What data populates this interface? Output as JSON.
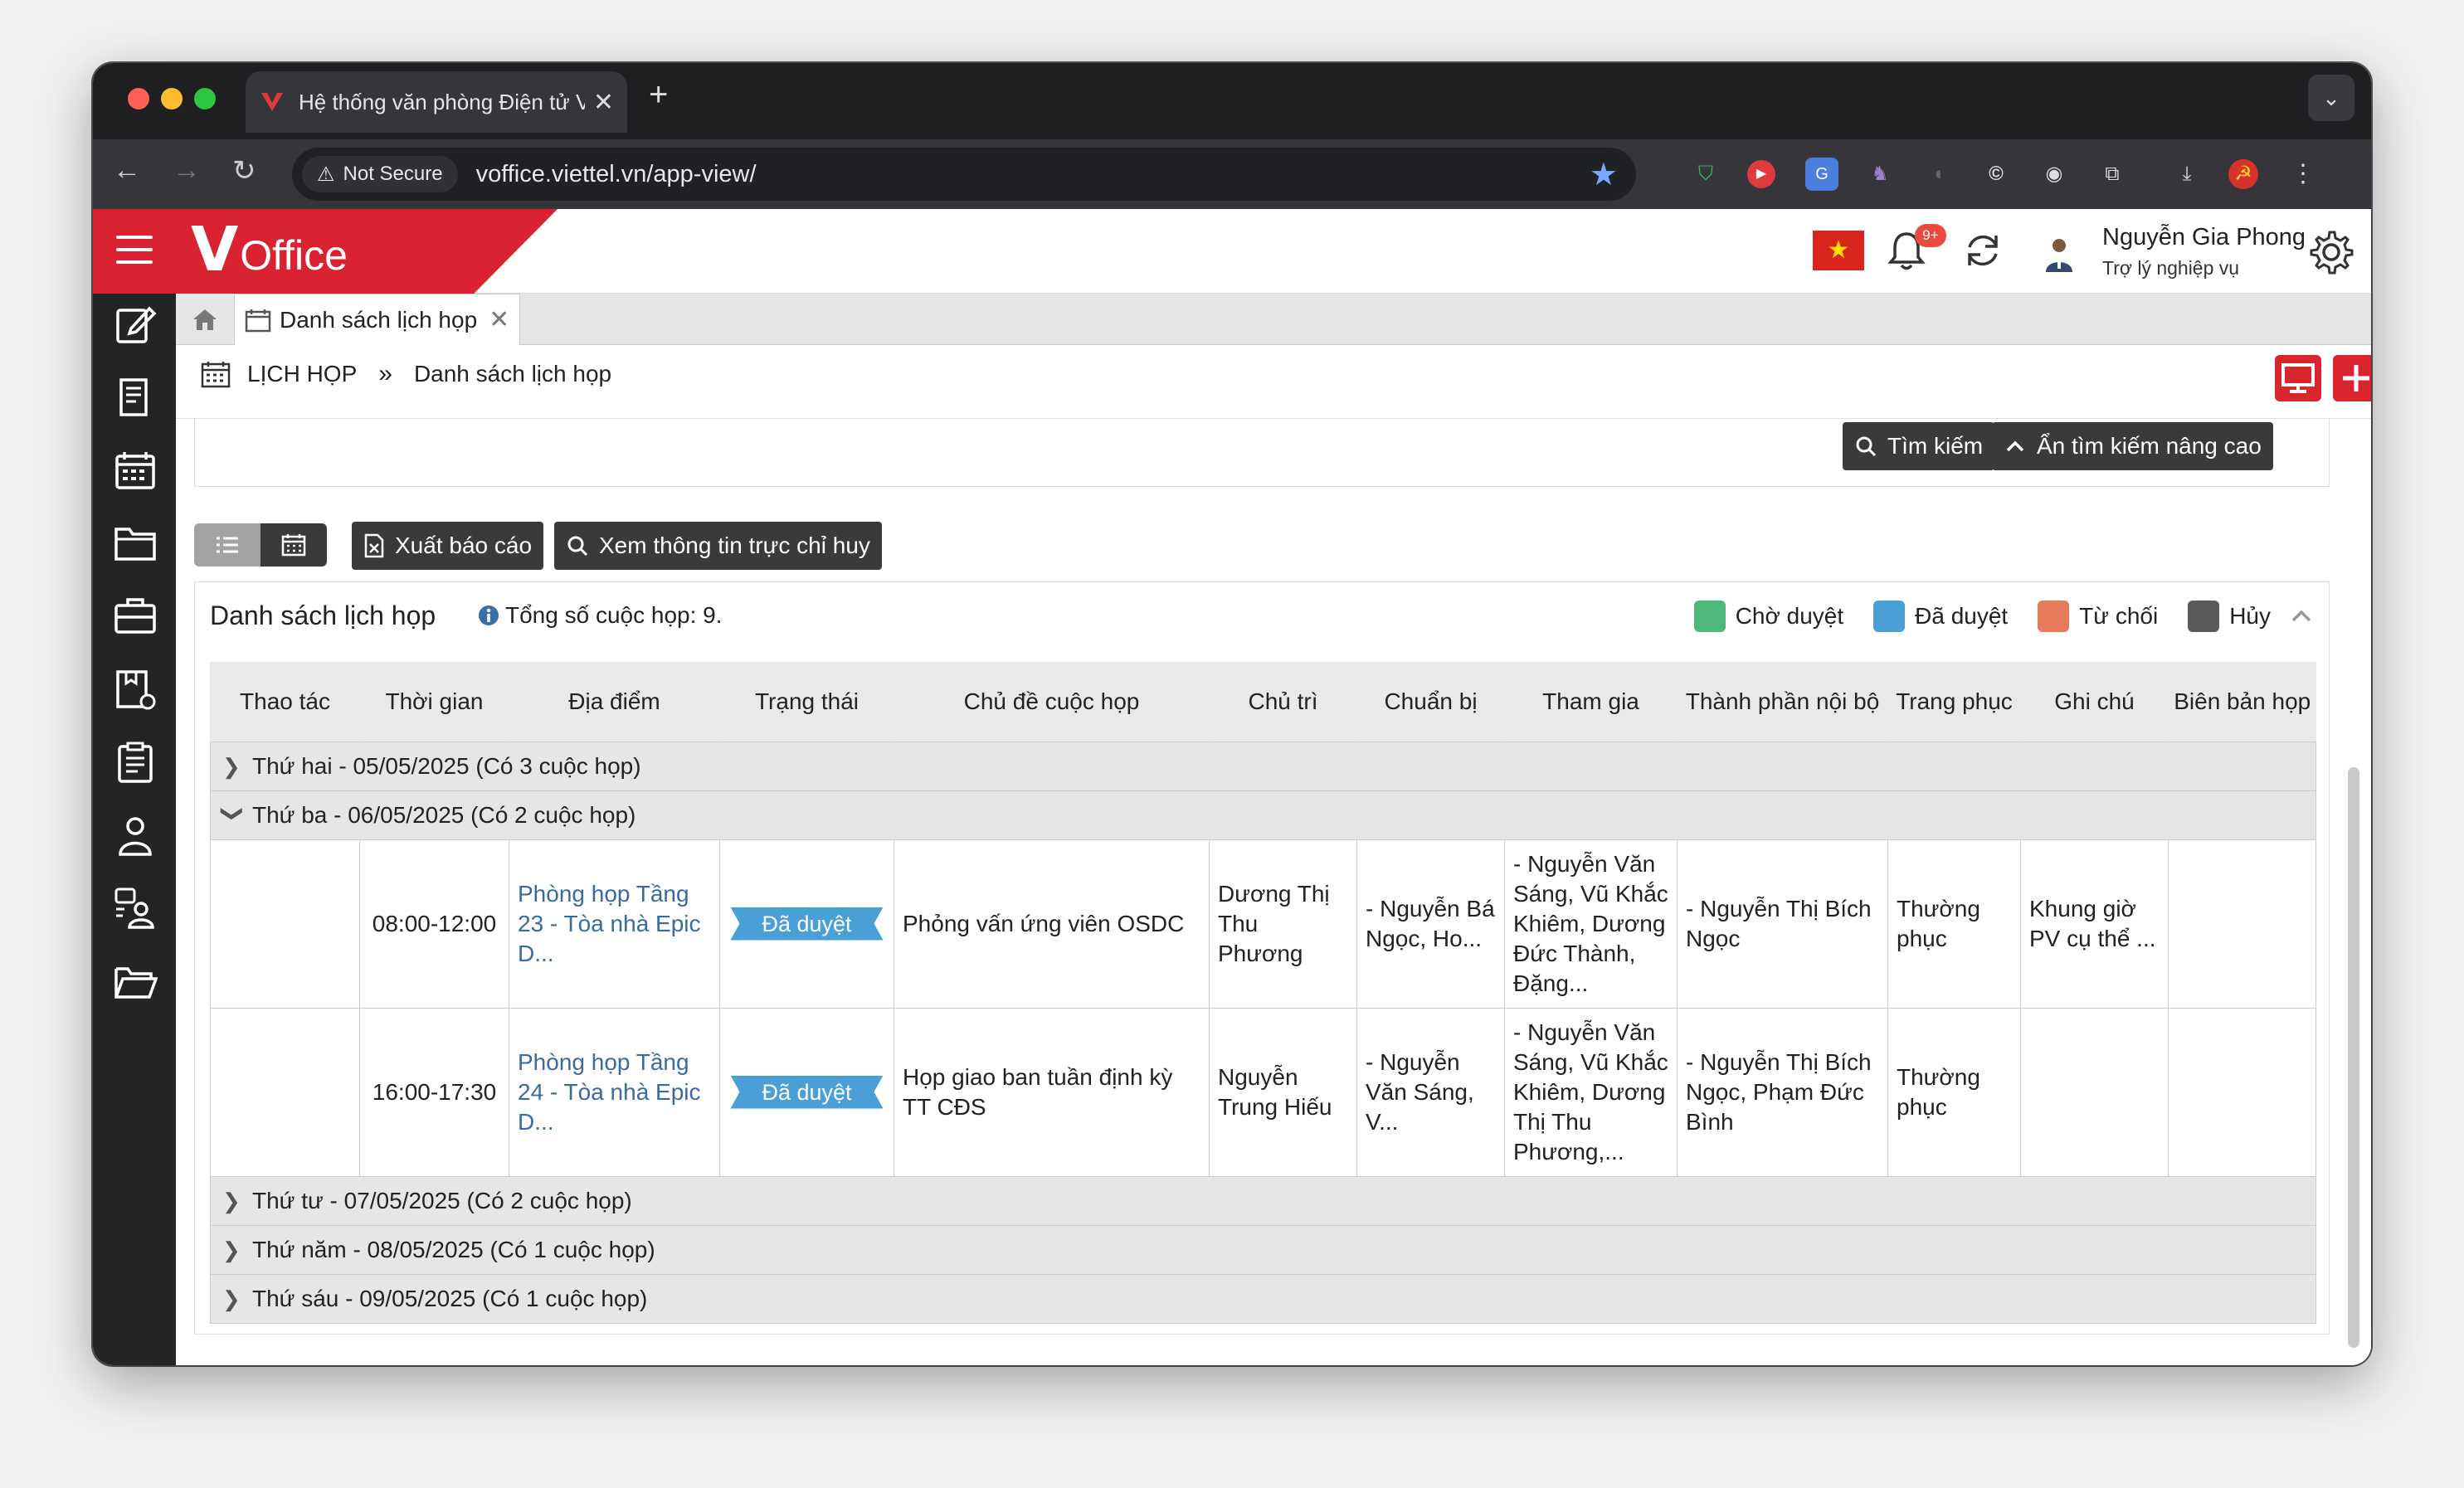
{
  "browser": {
    "tab_title": "Hệ thống văn phòng Điện tử V",
    "tab_close": "✕",
    "new_tab": "+",
    "security_label": "Not Secure",
    "url": "voffice.viettel.vn/app-view/"
  },
  "header": {
    "logo_v": "V",
    "logo_office": "Office",
    "notification_badge": "9+",
    "user_name": "Nguyễn Gia Phong",
    "user_role": "Trợ lý nghiệp vụ"
  },
  "page_tab": {
    "label": "Danh sách lịch họp",
    "close": "✕"
  },
  "breadcrumb": {
    "root": "LỊCH HỌP",
    "separator": "»",
    "current": "Danh sách lịch họp"
  },
  "search": {
    "search_btn": "Tìm kiếm",
    "toggle_btn": "Ẩn tìm kiếm nâng cao"
  },
  "actions": {
    "export_btn": "Xuất báo cáo",
    "view_info_btn": "Xem thông tin trực chỉ huy"
  },
  "panel": {
    "title": "Danh sách lịch họp",
    "total": "Tổng số cuộc họp: 9."
  },
  "legend": [
    {
      "label": "Chờ duyệt",
      "color": "#4cb87a"
    },
    {
      "label": "Đã duyệt",
      "color": "#4a9fd6"
    },
    {
      "label": "Từ chối",
      "color": "#e77a5d"
    },
    {
      "label": "Hủy",
      "color": "#5a5a5a"
    }
  ],
  "table": {
    "columns": [
      "Thao tác",
      "Thời gian",
      "Địa điểm",
      "Trạng thái",
      "Chủ đề cuộc họp",
      "Chủ trì",
      "Chuẩn bị",
      "Tham gia",
      "Thành phần nội bộ",
      "Trang phục",
      "Ghi chú",
      "Biên bản họp"
    ],
    "groups": [
      "Thứ hai - 05/05/2025 (Có 3 cuộc họp)",
      "Thứ ba - 06/05/2025 (Có 2 cuộc họp)",
      "Thứ tư - 07/05/2025 (Có 2 cuộc họp)",
      "Thứ năm - 08/05/2025 (Có 1 cuộc họp)",
      "Thứ sáu - 09/05/2025 (Có 1 cuộc họp)"
    ],
    "rows": [
      {
        "time": "08:00-12:00",
        "location": "Phòng họp Tầng 23 - Tòa nhà Epic D...",
        "status": "Đã duyệt",
        "topic": "Phỏng vấn ứng viên OSDC",
        "chair": "Dương Thị Thu Phương",
        "prepare": "- Nguyễn Bá Ngọc, Ho...",
        "attend": "- Nguyễn Văn Sáng, Vũ Khắc Khiêm, Dương Đức Thành, Đặng...",
        "internal": "- Nguyễn Thị Bích Ngọc",
        "dress": "Thường phục",
        "note": "Khung giờ PV cụ thể ...",
        "minutes": ""
      },
      {
        "time": "16:00-17:30",
        "location": "Phòng họp Tầng 24 - Tòa nhà Epic D...",
        "status": "Đã duyệt",
        "topic": "Họp giao ban tuần định kỳ TT CĐS",
        "chair": "Nguyễn Trung Hiếu",
        "prepare": "- Nguyễn Văn Sáng, V...",
        "attend": "- Nguyễn Văn Sáng, Vũ Khắc Khiêm, Dương Thị Thu Phương,...",
        "internal": "- Nguyễn Thị Bích Ngọc, Phạm Đức Bình",
        "dress": "Thường phục",
        "note": "",
        "minutes": ""
      }
    ]
  }
}
